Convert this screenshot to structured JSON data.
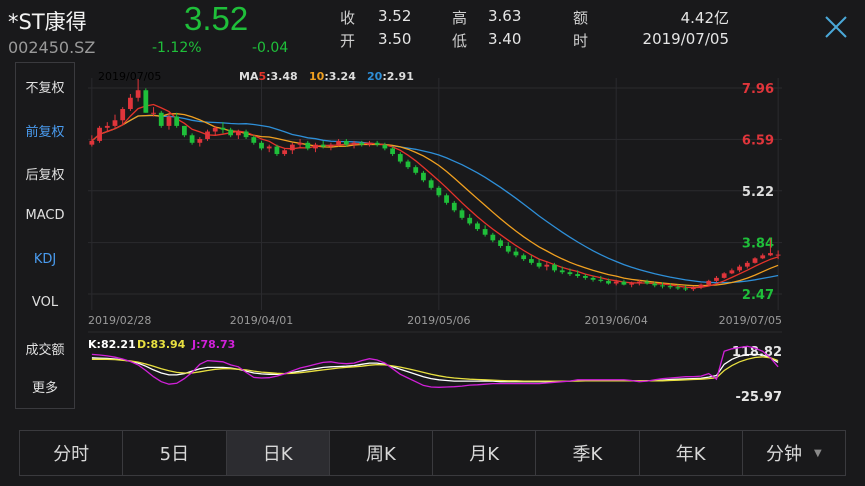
{
  "header": {
    "name": "*ST康得",
    "code": "002450.SZ",
    "price": "3.52",
    "change_pct": "-1.12%",
    "change": "-0.04",
    "quote": [
      {
        "label": "收",
        "value": "3.52"
      },
      {
        "label": "高",
        "value": "3.63"
      },
      {
        "label": "额",
        "value": "4.42亿"
      },
      {
        "label": "开",
        "value": "3.50"
      },
      {
        "label": "低",
        "value": "3.40"
      },
      {
        "label": "时",
        "value": "2019/07/05"
      }
    ],
    "close_icon": "close-x-icon"
  },
  "sidebar": {
    "items": [
      {
        "label": "不复权",
        "active": false
      },
      {
        "label": "前复权",
        "active": true
      },
      {
        "label": "后复权",
        "active": false
      },
      {
        "label": "MACD",
        "active": false
      },
      {
        "label": "KDJ",
        "active": true
      },
      {
        "label": "VOL",
        "active": false
      },
      {
        "label": "成交额",
        "active": false
      },
      {
        "label": "更多",
        "active": false
      }
    ]
  },
  "tabs": [
    {
      "label": "分时",
      "active": false
    },
    {
      "label": "5日",
      "active": false
    },
    {
      "label": "日K",
      "active": true
    },
    {
      "label": "周K",
      "active": false
    },
    {
      "label": "月K",
      "active": false
    },
    {
      "label": "季K",
      "active": false
    },
    {
      "label": "年K",
      "active": false
    },
    {
      "label": "分钟",
      "active": false,
      "dropdown": true
    }
  ],
  "colors": {
    "up": "#e0353b",
    "down": "#1fbf3a",
    "ma5": "#e5332a",
    "ma10": "#f0a020",
    "ma20": "#2e8fd8",
    "k": "#ffffff",
    "d": "#e8e040",
    "j": "#d020d8",
    "accent": "#4a9cf0"
  },
  "chart_data": [
    {
      "type": "candlestick",
      "title": "",
      "top_date_label": "2019/07/05",
      "legend": [
        {
          "prefix": "MA",
          "period": "5",
          "value": "3.48",
          "color": "#e5332a"
        },
        {
          "period": "10",
          "value": "3.24",
          "color": "#f0a020"
        },
        {
          "period": "20",
          "value": "2.91",
          "color": "#2e8fd8"
        }
      ],
      "y_ticks": [
        {
          "value": 7.96,
          "label": "7.96",
          "color": "#e0353b"
        },
        {
          "value": 6.59,
          "label": "6.59",
          "color": "#e0353b"
        },
        {
          "value": 5.22,
          "label": "5.22",
          "color": "#dddddd"
        },
        {
          "value": 3.84,
          "label": "3.84",
          "color": "#1fbf3a"
        },
        {
          "value": 2.47,
          "label": "2.47",
          "color": "#1fbf3a"
        }
      ],
      "ylim": [
        2.47,
        7.96
      ],
      "x_labels": [
        "2019/02/28",
        "2019/04/01",
        "2019/05/06",
        "2019/06/04",
        "2019/07/05"
      ],
      "x_label_index": [
        0,
        22,
        45,
        68,
        89
      ],
      "n": 90,
      "ohlc": [
        [
          6.45,
          6.7,
          6.4,
          6.55
        ],
        [
          6.55,
          6.95,
          6.5,
          6.9
        ],
        [
          6.9,
          7.05,
          6.8,
          6.95
        ],
        [
          6.95,
          7.25,
          6.9,
          7.1
        ],
        [
          7.1,
          7.45,
          7.0,
          7.4
        ],
        [
          7.4,
          7.8,
          7.35,
          7.7
        ],
        [
          7.7,
          8.2,
          7.6,
          7.9
        ],
        [
          7.9,
          7.95,
          7.3,
          7.3
        ],
        [
          7.3,
          7.45,
          7.2,
          7.3
        ],
        [
          7.3,
          7.35,
          6.9,
          6.95
        ],
        [
          6.95,
          7.3,
          6.85,
          7.2
        ],
        [
          7.2,
          7.3,
          6.9,
          6.95
        ],
        [
          6.95,
          6.95,
          6.65,
          6.7
        ],
        [
          6.7,
          6.75,
          6.45,
          6.5
        ],
        [
          6.5,
          6.65,
          6.4,
          6.6
        ],
        [
          6.6,
          6.85,
          6.55,
          6.8
        ],
        [
          6.8,
          6.95,
          6.7,
          6.9
        ],
        [
          6.9,
          7.05,
          6.75,
          6.85
        ],
        [
          6.85,
          6.9,
          6.65,
          6.7
        ],
        [
          6.7,
          6.85,
          6.6,
          6.8
        ],
        [
          6.8,
          6.85,
          6.6,
          6.65
        ],
        [
          6.65,
          6.7,
          6.45,
          6.5
        ],
        [
          6.5,
          6.55,
          6.3,
          6.35
        ],
        [
          6.35,
          6.45,
          6.25,
          6.4
        ],
        [
          6.4,
          6.45,
          6.15,
          6.2
        ],
        [
          6.2,
          6.35,
          6.15,
          6.3
        ],
        [
          6.3,
          6.5,
          6.2,
          6.45
        ],
        [
          6.45,
          6.6,
          6.35,
          6.5
        ],
        [
          6.5,
          6.55,
          6.3,
          6.35
        ],
        [
          6.35,
          6.5,
          6.25,
          6.45
        ],
        [
          6.45,
          6.55,
          6.35,
          6.4
        ],
        [
          6.4,
          6.5,
          6.3,
          6.45
        ],
        [
          6.45,
          6.6,
          6.4,
          6.55
        ],
        [
          6.55,
          6.6,
          6.4,
          6.45
        ],
        [
          6.45,
          6.55,
          6.35,
          6.5
        ],
        [
          6.5,
          6.55,
          6.4,
          6.45
        ],
        [
          6.45,
          6.55,
          6.4,
          6.5
        ],
        [
          6.5,
          6.55,
          6.4,
          6.45
        ],
        [
          6.45,
          6.5,
          6.3,
          6.35
        ],
        [
          6.35,
          6.4,
          6.15,
          6.2
        ],
        [
          6.2,
          6.25,
          5.95,
          6.0
        ],
        [
          6.0,
          6.05,
          5.8,
          5.85
        ],
        [
          5.85,
          5.9,
          5.65,
          5.7
        ],
        [
          5.7,
          5.75,
          5.45,
          5.5
        ],
        [
          5.5,
          5.55,
          5.25,
          5.3
        ],
        [
          5.3,
          5.35,
          5.05,
          5.1
        ],
        [
          5.1,
          5.15,
          4.85,
          4.9
        ],
        [
          4.9,
          4.95,
          4.65,
          4.7
        ],
        [
          4.7,
          4.75,
          4.45,
          4.5
        ],
        [
          4.5,
          4.6,
          4.3,
          4.35
        ],
        [
          4.35,
          4.4,
          4.15,
          4.2
        ],
        [
          4.2,
          4.3,
          4.0,
          4.05
        ],
        [
          4.05,
          4.1,
          3.85,
          3.9
        ],
        [
          3.9,
          3.95,
          3.7,
          3.75
        ],
        [
          3.75,
          3.85,
          3.55,
          3.6
        ],
        [
          3.6,
          3.7,
          3.45,
          3.5
        ],
        [
          3.5,
          3.55,
          3.35,
          3.4
        ],
        [
          3.4,
          3.5,
          3.25,
          3.3
        ],
        [
          3.3,
          3.4,
          3.15,
          3.2
        ],
        [
          3.2,
          3.35,
          3.1,
          3.25
        ],
        [
          3.25,
          3.3,
          3.05,
          3.1
        ],
        [
          3.1,
          3.2,
          3.0,
          3.05
        ],
        [
          3.05,
          3.15,
          2.95,
          3.0
        ],
        [
          3.0,
          3.1,
          2.9,
          2.95
        ],
        [
          2.95,
          3.0,
          2.85,
          2.9
        ],
        [
          2.9,
          2.95,
          2.8,
          2.85
        ],
        [
          2.85,
          2.95,
          2.78,
          2.82
        ],
        [
          2.82,
          2.88,
          2.72,
          2.75
        ],
        [
          2.75,
          2.85,
          2.7,
          2.8
        ],
        [
          2.8,
          2.85,
          2.7,
          2.72
        ],
        [
          2.72,
          2.8,
          2.65,
          2.75
        ],
        [
          2.75,
          2.85,
          2.7,
          2.8
        ],
        [
          2.8,
          2.85,
          2.72,
          2.75
        ],
        [
          2.75,
          2.8,
          2.65,
          2.7
        ],
        [
          2.7,
          2.78,
          2.62,
          2.68
        ],
        [
          2.68,
          2.75,
          2.6,
          2.65
        ],
        [
          2.65,
          2.72,
          2.58,
          2.62
        ],
        [
          2.62,
          2.7,
          2.55,
          2.6
        ],
        [
          2.6,
          2.68,
          2.55,
          2.65
        ],
        [
          2.65,
          2.75,
          2.6,
          2.72
        ],
        [
          2.72,
          2.85,
          2.68,
          2.82
        ],
        [
          2.82,
          2.95,
          2.78,
          2.9
        ],
        [
          2.9,
          3.05,
          2.88,
          3.02
        ],
        [
          3.02,
          3.15,
          3.0,
          3.1
        ],
        [
          3.1,
          3.25,
          3.05,
          3.2
        ],
        [
          3.2,
          3.35,
          3.15,
          3.3
        ],
        [
          3.3,
          3.45,
          3.28,
          3.42
        ],
        [
          3.42,
          3.55,
          3.4,
          3.5
        ],
        [
          3.5,
          3.95,
          3.48,
          3.56
        ],
        [
          3.5,
          3.63,
          3.4,
          3.52
        ]
      ]
    },
    {
      "type": "line",
      "title": "",
      "legend": [
        {
          "name": "K",
          "value": "82.21",
          "color": "#ffffff"
        },
        {
          "name": "D",
          "value": "83.94",
          "color": "#e8e040"
        },
        {
          "name": "J",
          "value": "78.73",
          "color": "#d020d8"
        }
      ],
      "y_ticks": [
        {
          "value": 118.82,
          "label": "118.82"
        },
        {
          "value": -25.97,
          "label": "-25.97"
        }
      ],
      "ylim": [
        -25.97,
        118.82
      ],
      "n": 90,
      "series": [
        {
          "name": "K",
          "values": [
            97,
            96,
            95,
            93,
            90,
            86,
            80,
            70,
            58,
            48,
            42,
            42,
            46,
            54,
            62,
            66,
            66,
            66,
            64,
            60,
            54,
            48,
            45,
            44,
            44,
            46,
            50,
            54,
            58,
            62,
            66,
            68,
            69,
            70,
            72,
            76,
            80,
            80,
            76,
            68,
            60,
            52,
            44,
            36,
            30,
            26,
            24,
            22,
            22,
            22,
            22,
            22,
            22,
            20,
            20,
            20,
            20,
            20,
            20,
            20,
            20,
            21,
            22,
            24,
            24,
            24,
            24,
            24,
            24,
            24,
            23,
            22,
            23,
            24,
            25,
            27,
            28,
            29,
            30,
            31,
            35,
            40,
            76,
            92,
            102,
            107,
            108,
            106,
            97,
            82
          ]
        },
        {
          "name": "D",
          "values": [
            92,
            92,
            92,
            91,
            89,
            87,
            83,
            77,
            70,
            62,
            55,
            50,
            48,
            48,
            52,
            56,
            60,
            62,
            62,
            60,
            58,
            54,
            51,
            49,
            47,
            46,
            47,
            49,
            52,
            55,
            58,
            61,
            64,
            66,
            68,
            70,
            73,
            75,
            74,
            71,
            67,
            62,
            56,
            50,
            44,
            39,
            35,
            32,
            30,
            28,
            27,
            26,
            25,
            24,
            23,
            23,
            22,
            22,
            22,
            22,
            22,
            22,
            22,
            22,
            23,
            23,
            23,
            23,
            23,
            23,
            23,
            23,
            23,
            23,
            23,
            24,
            25,
            26,
            27,
            28,
            30,
            33,
            56,
            72,
            84,
            92,
            98,
            100,
            97,
            88
          ]
        },
        {
          "name": "J",
          "values": [
            108,
            106,
            103,
            99,
            93,
            85,
            74,
            56,
            36,
            20,
            12,
            15,
            30,
            50,
            76,
            88,
            86,
            84,
            74,
            68,
            50,
            34,
            32,
            33,
            38,
            45,
            55,
            64,
            70,
            76,
            82,
            84,
            80,
            78,
            80,
            88,
            94,
            90,
            80,
            62,
            44,
            32,
            20,
            8,
            3,
            2,
            3,
            4,
            6,
            9,
            10,
            12,
            14,
            14,
            14,
            14,
            14,
            14,
            14,
            16,
            18,
            20,
            22,
            26,
            26,
            26,
            26,
            26,
            26,
            26,
            24,
            20,
            22,
            26,
            30,
            32,
            34,
            36,
            36,
            38,
            46,
            28,
            118,
            126,
            130,
            134,
            128,
            118,
            97,
            68
          ]
        }
      ]
    }
  ]
}
